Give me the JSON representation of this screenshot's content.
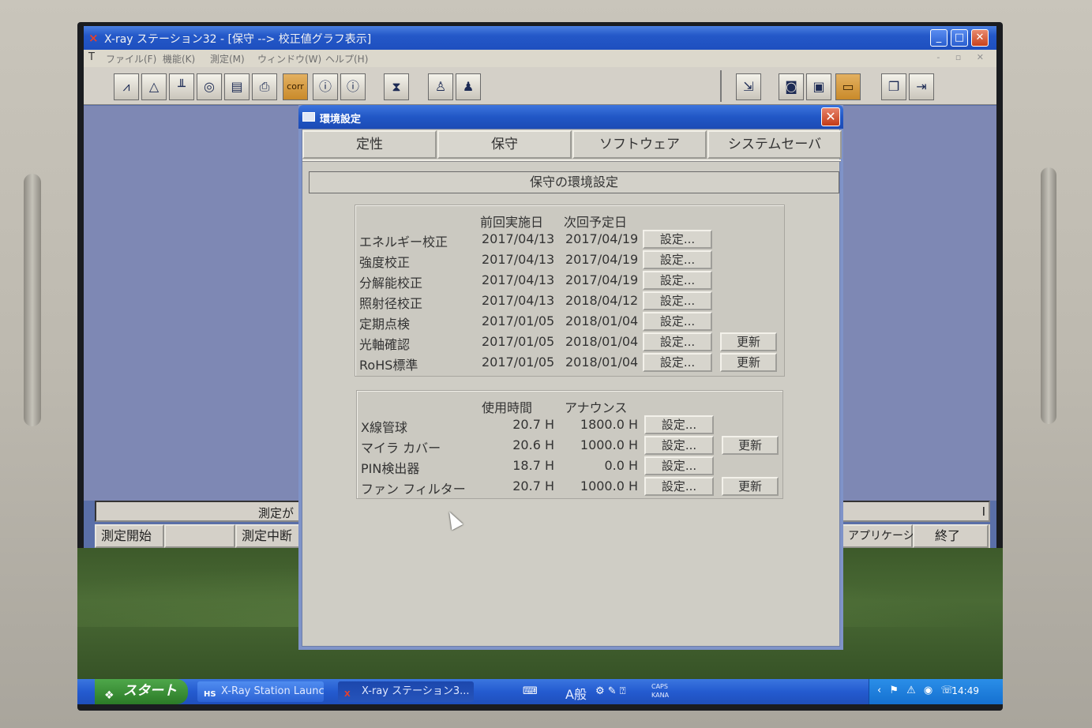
{
  "app": {
    "title": "X-ray ステーション32 - [保守 --> 校正値グラフ表示]",
    "title_controls": [
      "_",
      "□",
      "✕"
    ],
    "menu": [
      "ファイル(F)",
      "機能(K)",
      "測定(M)",
      "ウィンドウ(W)",
      "ヘルプ(H)"
    ],
    "toolbar_selected_label": "corr",
    "measure_status": "測定が",
    "measure_status_right": "I",
    "bottom_buttons": {
      "start": "測定開始",
      "stop": "測定中断",
      "application": "アプリケーション",
      "exit": "終了"
    }
  },
  "dialog": {
    "title": "環境設定",
    "close": "✕",
    "tabs": [
      "定性",
      "保守",
      "ソフトウェア",
      "システムセーバ"
    ],
    "section_header": "保守の環境設定",
    "calibration": {
      "headers": {
        "last": "前回実施日",
        "next": "次回予定日"
      },
      "rows": [
        {
          "label": "エネルギー校正",
          "last": "2017/04/13",
          "next": "2017/04/19",
          "setting": "設定...",
          "update": ""
        },
        {
          "label": "強度校正",
          "last": "2017/04/13",
          "next": "2017/04/19",
          "setting": "設定...",
          "update": ""
        },
        {
          "label": "分解能校正",
          "last": "2017/04/13",
          "next": "2017/04/19",
          "setting": "設定...",
          "update": ""
        },
        {
          "label": "照射径校正",
          "last": "2017/04/13",
          "next": "2018/04/12",
          "setting": "設定...",
          "update": ""
        },
        {
          "label": "定期点検",
          "last": "2017/01/05",
          "next": "2018/01/04",
          "setting": "設定...",
          "update": ""
        },
        {
          "label": "光軸確認",
          "last": "2017/01/05",
          "next": "2018/01/04",
          "setting": "設定...",
          "update": "更新"
        },
        {
          "label": "RoHS標準",
          "last": "2017/01/05",
          "next": "2018/01/04",
          "setting": "設定...",
          "update": "更新"
        }
      ]
    },
    "usage": {
      "headers": {
        "hours": "使用時間",
        "announce": "アナウンス"
      },
      "rows": [
        {
          "label": "X線管球",
          "hours": "20.7 H",
          "announce": "1800.0 H",
          "setting": "設定...",
          "update": ""
        },
        {
          "label": "マイラ カバー",
          "hours": "20.6 H",
          "announce": "1000.0 H",
          "setting": "設定...",
          "update": "更新"
        },
        {
          "label": "PIN検出器",
          "hours": "18.7 H",
          "announce": "0.0 H",
          "setting": "設定...",
          "update": ""
        },
        {
          "label": "ファン フィルター",
          "hours": "20.7 H",
          "announce": "1000.0 H",
          "setting": "設定...",
          "update": "更新"
        }
      ]
    }
  },
  "taskbar": {
    "start": "スタート",
    "tasks": [
      {
        "icon": "HS",
        "label": "X-Ray Station Launc..."
      },
      {
        "icon": "X",
        "label": "X-ray ステーション3..."
      }
    ],
    "ime": "A般",
    "caps": "CAPS",
    "kana": "KANA",
    "clock": "14:49"
  },
  "colors": {
    "xp_blue": "#245bd0",
    "dialog_face": "#cfcdc5",
    "close_red": "#c33b16",
    "start_green": "#2b7a27"
  }
}
